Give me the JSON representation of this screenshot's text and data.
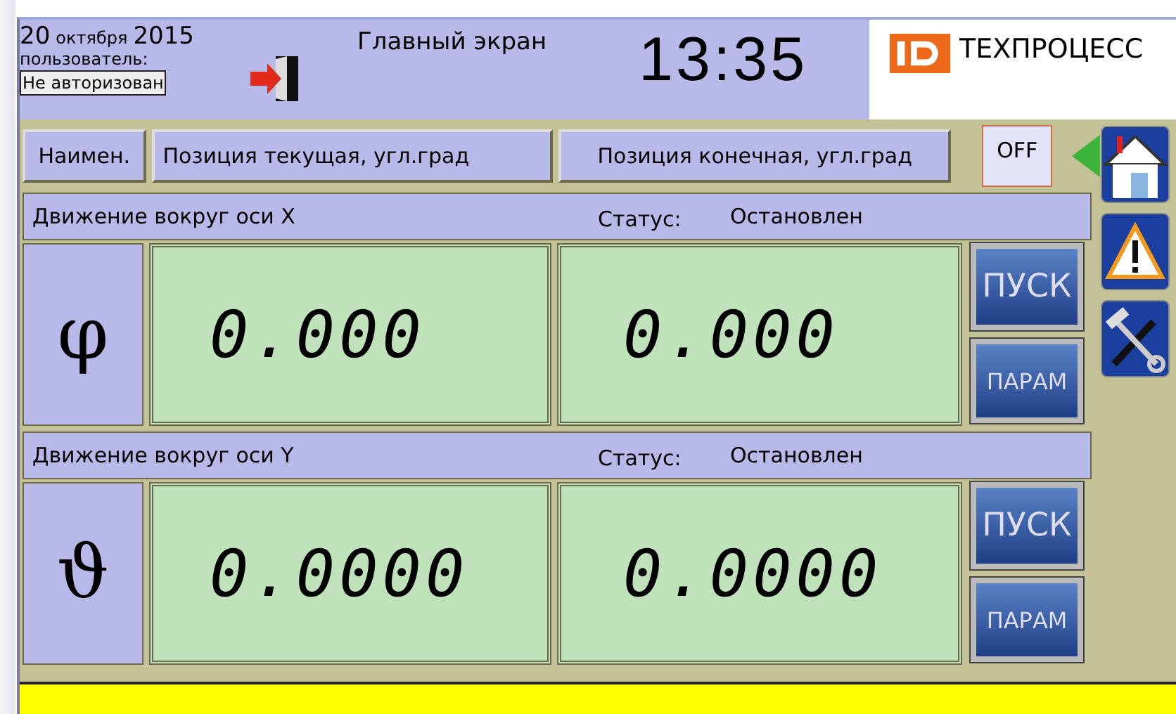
{
  "header": {
    "date_day": "20",
    "date_month": "октября",
    "date_year": "2015",
    "user_label": "пользователь:",
    "user_value": "Не авторизован",
    "title": "Главный экран",
    "clock": "13:35",
    "logo_text": "ТЕХПРОЦЕСС"
  },
  "columns": [
    "Наимен.",
    "Позиция текущая, угл.град",
    "Позиция конечная, угл.град"
  ],
  "toggle": {
    "label": "OFF",
    "on": false
  },
  "axes": [
    {
      "title": "Движение вокруг оси X",
      "status_label": "Статус:",
      "status": "Остановлен",
      "symbol": "φ",
      "current": "0.000",
      "target": "0.000",
      "buttons": [
        "ПУСК",
        "ПАРАМ"
      ]
    },
    {
      "title": "Движение вокруг оси Y",
      "status_label": "Статус:",
      "status": "Остановлен",
      "symbol": "ϑ",
      "current": "0.0000",
      "target": "0.0000",
      "buttons": [
        "ПУСК",
        "ПАРАМ"
      ]
    }
  ]
}
